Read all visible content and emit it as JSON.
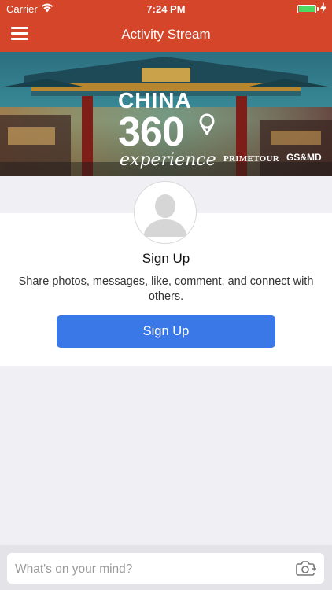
{
  "status_bar": {
    "carrier": "Carrier",
    "time": "7:24 PM",
    "battery_level": 1.0,
    "wifi_icon": "wifi-icon",
    "charging_icon": "charging-bolt-icon"
  },
  "nav": {
    "title": "Activity Stream",
    "menu_icon": "hamburger-menu-icon"
  },
  "banner": {
    "line1": "CHINA",
    "line2": "360",
    "line3": "experience",
    "sponsor1": "PRIMETOUR",
    "sponsor2": "GS&MD"
  },
  "signup": {
    "title": "Sign Up",
    "description": "Share photos, messages, like, comment, and connect with others.",
    "button_label": "Sign Up",
    "avatar_icon": "default-avatar-icon"
  },
  "composer": {
    "placeholder": "What's on your mind?",
    "camera_icon": "camera-add-icon"
  },
  "colors": {
    "brand_red": "#d4452a",
    "button_blue": "#3b78e7",
    "background": "#efeff4"
  }
}
